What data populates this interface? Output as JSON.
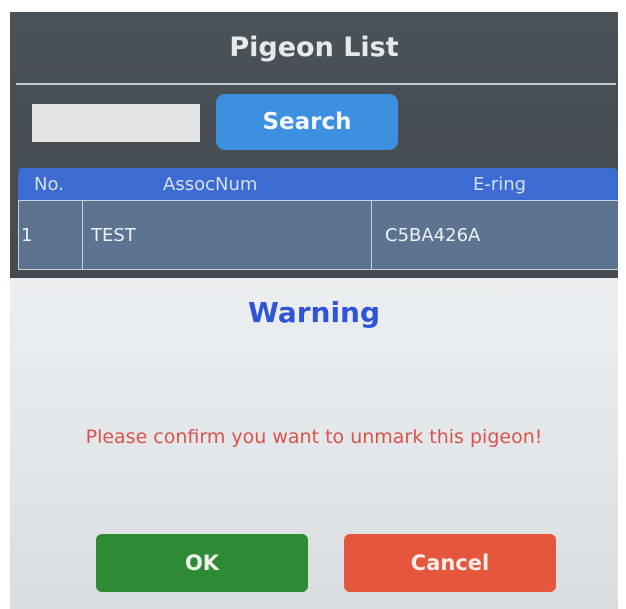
{
  "header": {
    "title": "Pigeon List"
  },
  "search": {
    "value": "",
    "placeholder": "",
    "button_label": "Search"
  },
  "table": {
    "columns": [
      "No.",
      "AssocNum",
      "E-ring"
    ],
    "rows": [
      [
        "1",
        "TEST",
        "C5BA426A"
      ]
    ]
  },
  "dialog": {
    "title": "Warning",
    "message": "Please confirm you want to unmark this pigeon!",
    "ok_label": "OK",
    "cancel_label": "Cancel"
  },
  "colors": {
    "screen_bg": "#454b50",
    "search_button": "#3d8fe0",
    "table_header": "#3c6bd1",
    "table_row": "#5c7392",
    "dialog_bg": "#e4e8eb",
    "warning_title": "#2f55d6",
    "message_text": "#d9534a",
    "ok_button": "#2f8a34",
    "cancel_button": "#e4573d"
  }
}
